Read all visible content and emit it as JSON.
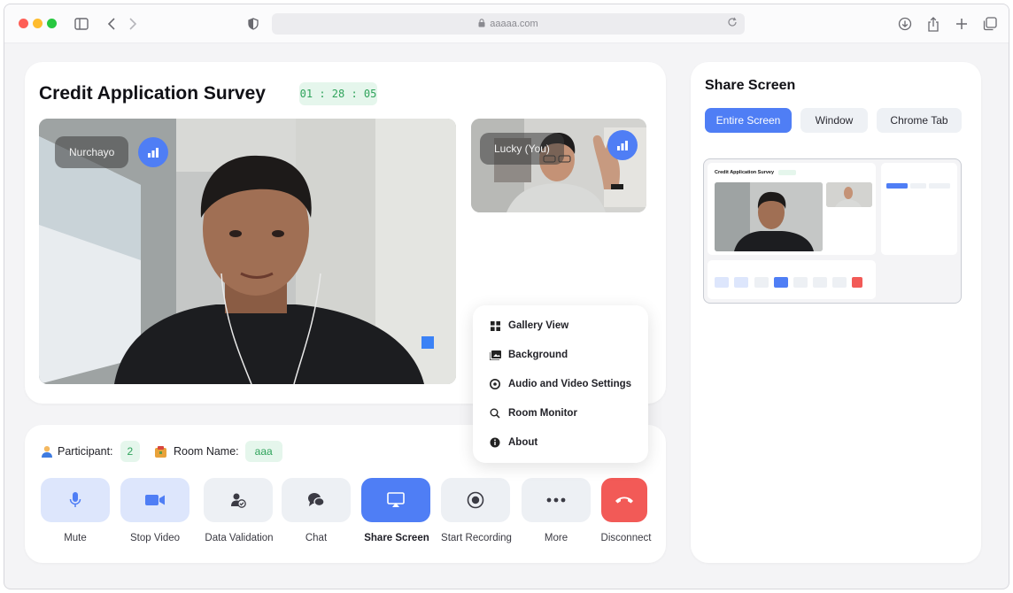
{
  "browser": {
    "url": "aaaaa.com"
  },
  "meeting": {
    "title": "Credit Application Survey",
    "timer": "01 : 28 : 05",
    "main_participant": "Nurchayo",
    "self_participant": "Lucky (You)"
  },
  "menu": {
    "items": [
      {
        "label": "Gallery View",
        "icon": "grid-icon"
      },
      {
        "label": "Background",
        "icon": "image-icon"
      },
      {
        "label": "Audio and Video Settings",
        "icon": "settings-icon"
      },
      {
        "label": "Room Monitor",
        "icon": "search-icon"
      },
      {
        "label": "About",
        "icon": "info-icon"
      }
    ]
  },
  "room": {
    "participant_label": "Participant:",
    "participant_count": "2",
    "room_name_label": "Room Name:",
    "room_name": "aaa"
  },
  "controls": [
    {
      "label": "Mute",
      "icon": "microphone-icon"
    },
    {
      "label": "Stop Video",
      "icon": "video-camera-icon"
    },
    {
      "label": "Data Validation",
      "icon": "user-check-icon"
    },
    {
      "label": "Chat",
      "icon": "chat-bubbles-icon"
    },
    {
      "label": "Share Screen",
      "icon": "screen-share-icon"
    },
    {
      "label": "Start Recording",
      "icon": "record-icon"
    },
    {
      "label": "More",
      "icon": "more-dots-icon"
    },
    {
      "label": "Disconnect",
      "icon": "phone-hangup-icon"
    }
  ],
  "share_screen": {
    "title": "Share Screen",
    "tabs": [
      "Entire Screen",
      "Window",
      "Chrome Tab"
    ],
    "active_tab": "Entire Screen",
    "preview_title": "Credit Application Survey"
  },
  "colors": {
    "accent": "#4f7ef5",
    "danger": "#f25a57",
    "success_bg": "#e5f6ec",
    "success_text": "#2fa35b"
  }
}
